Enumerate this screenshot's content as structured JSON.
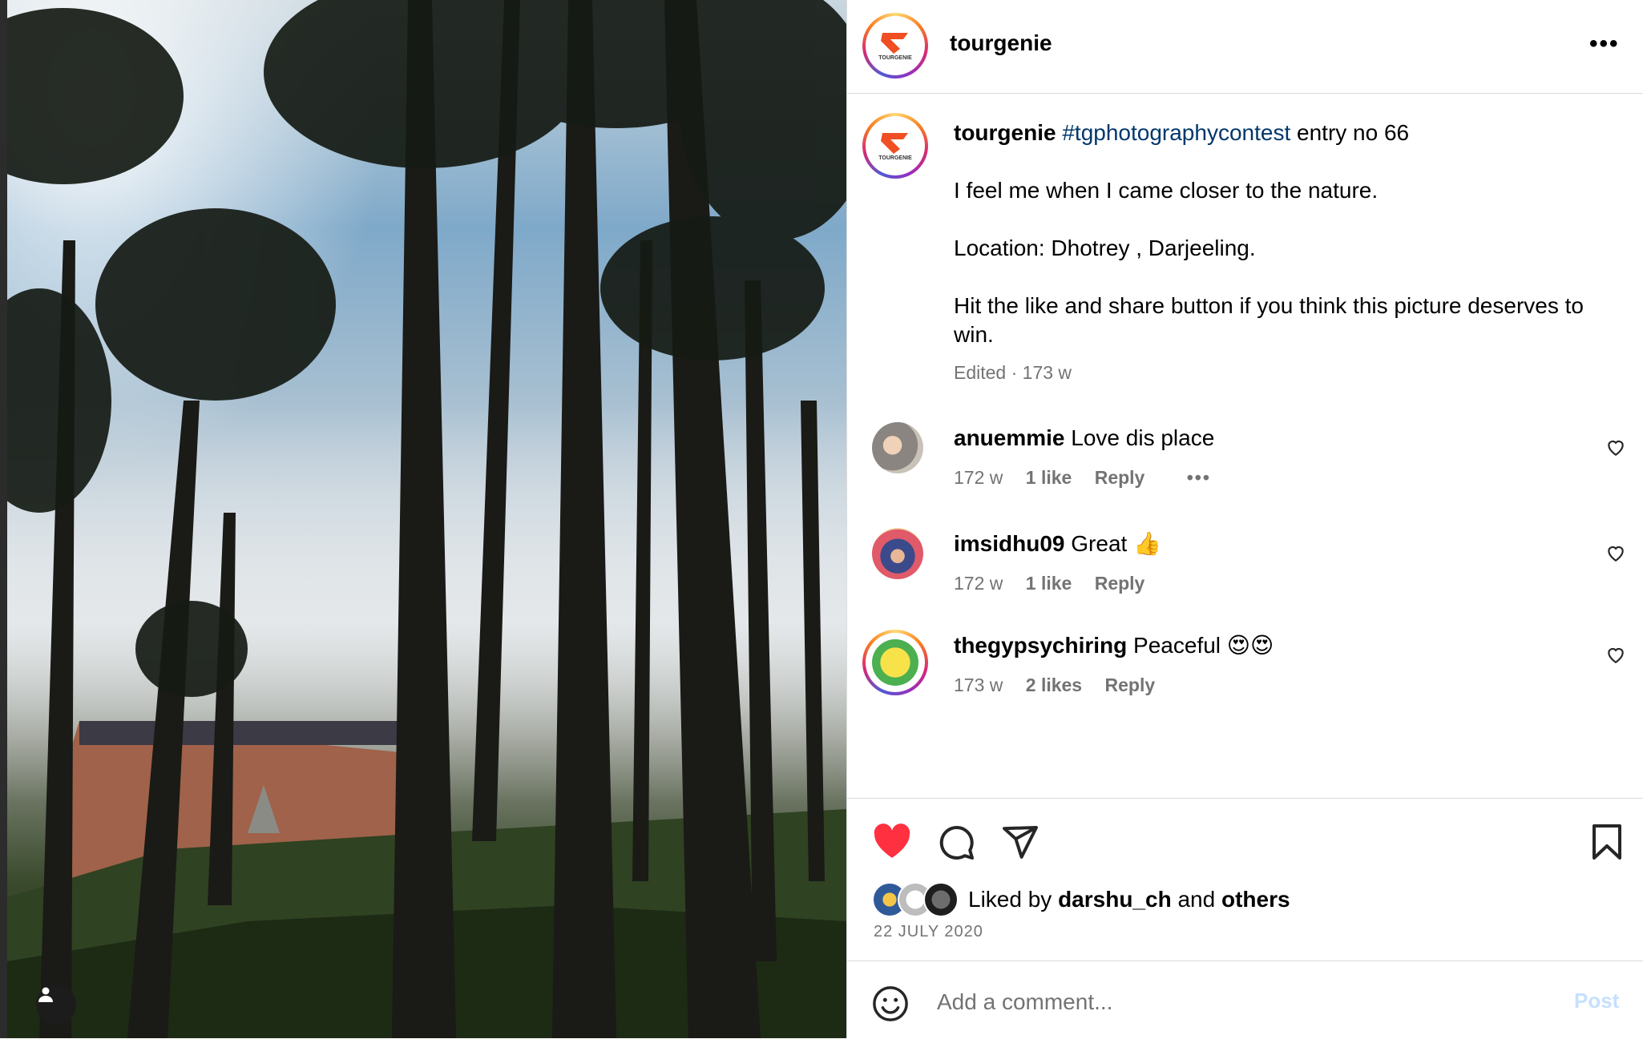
{
  "post": {
    "username": "tourgenie",
    "logo_text": "TOURGENIE",
    "caption": {
      "username": "tourgenie",
      "hashtag": "#tgphotographycontest",
      "first_line_rest": " entry no 66",
      "line2": "I feel me when I came closer to the nature.",
      "line3": "Location: Dhotrey , Darjeeling.",
      "line4": "Hit the like and share button if you think this picture deserves to win.",
      "meta": "Edited · 173 w"
    },
    "more_icon": "more-horizontal-icon"
  },
  "comments": [
    {
      "username": "anuemmie",
      "text": " Love dis place",
      "age": "172 w",
      "likes": "1 like",
      "reply": "Reply",
      "more": "•••"
    },
    {
      "username": "imsidhu09",
      "text": " Great 👍",
      "age": "172 w",
      "likes": "1 like",
      "reply": "Reply"
    },
    {
      "username": "thegypsychiring",
      "text": " Peaceful 😍😍",
      "age": "173 w",
      "likes": "2 likes",
      "reply": "Reply"
    }
  ],
  "actions": {
    "liked": true,
    "like_color": "#ff3040",
    "liked_by_prefix": "Liked by ",
    "liked_by_user": "darshu_ch",
    "liked_by_middle": " and ",
    "liked_by_others": "others",
    "date": "22 JULY 2020"
  },
  "add_comment": {
    "placeholder": "Add a comment...",
    "post_label": "Post"
  },
  "colors": {
    "hashtag": "#00376b",
    "secondary_text": "#737373",
    "border": "#dbdbdb",
    "post_disabled": "#c6e0fd",
    "logo_red": "#f04e23"
  }
}
